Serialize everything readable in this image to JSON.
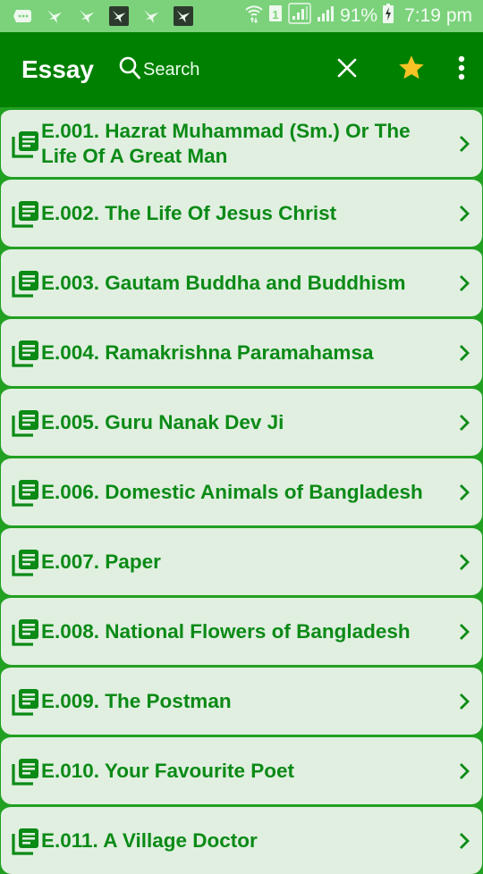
{
  "status_bar": {
    "notification_icons": [
      "messages-icon",
      "bird-app-icon",
      "bird-app-icon",
      "bird-app-dark-icon",
      "bird-app-icon",
      "bird-app-dark-icon"
    ],
    "battery": "91%",
    "time": "7:19 pm",
    "sim_slot": "1"
  },
  "app_bar": {
    "title": "Essay",
    "search_placeholder": "Search",
    "colors": {
      "background": "#008000",
      "star": "#f7c325"
    }
  },
  "list": {
    "items": [
      {
        "label": "E.001. Hazrat Muhammad (Sm.) Or The Life Of A Great Man"
      },
      {
        "label": "E.002. The Life Of Jesus Christ"
      },
      {
        "label": "E.003. Gautam Buddha and Buddhism"
      },
      {
        "label": "E.004. Ramakrishna Paramahamsa"
      },
      {
        "label": "E.005. Guru Nanak Dev Ji"
      },
      {
        "label": "E.006. Domestic Animals of Bangladesh"
      },
      {
        "label": "E.007. Paper"
      },
      {
        "label": "E.008. National Flowers of Bangladesh"
      },
      {
        "label": "E.009. The Postman"
      },
      {
        "label": "E.010. Your Favourite Poet"
      },
      {
        "label": "E.011. A Village Doctor"
      }
    ],
    "colors": {
      "text": "#0b8a16",
      "card": "#e0efe0",
      "separator": "#21a021"
    }
  }
}
